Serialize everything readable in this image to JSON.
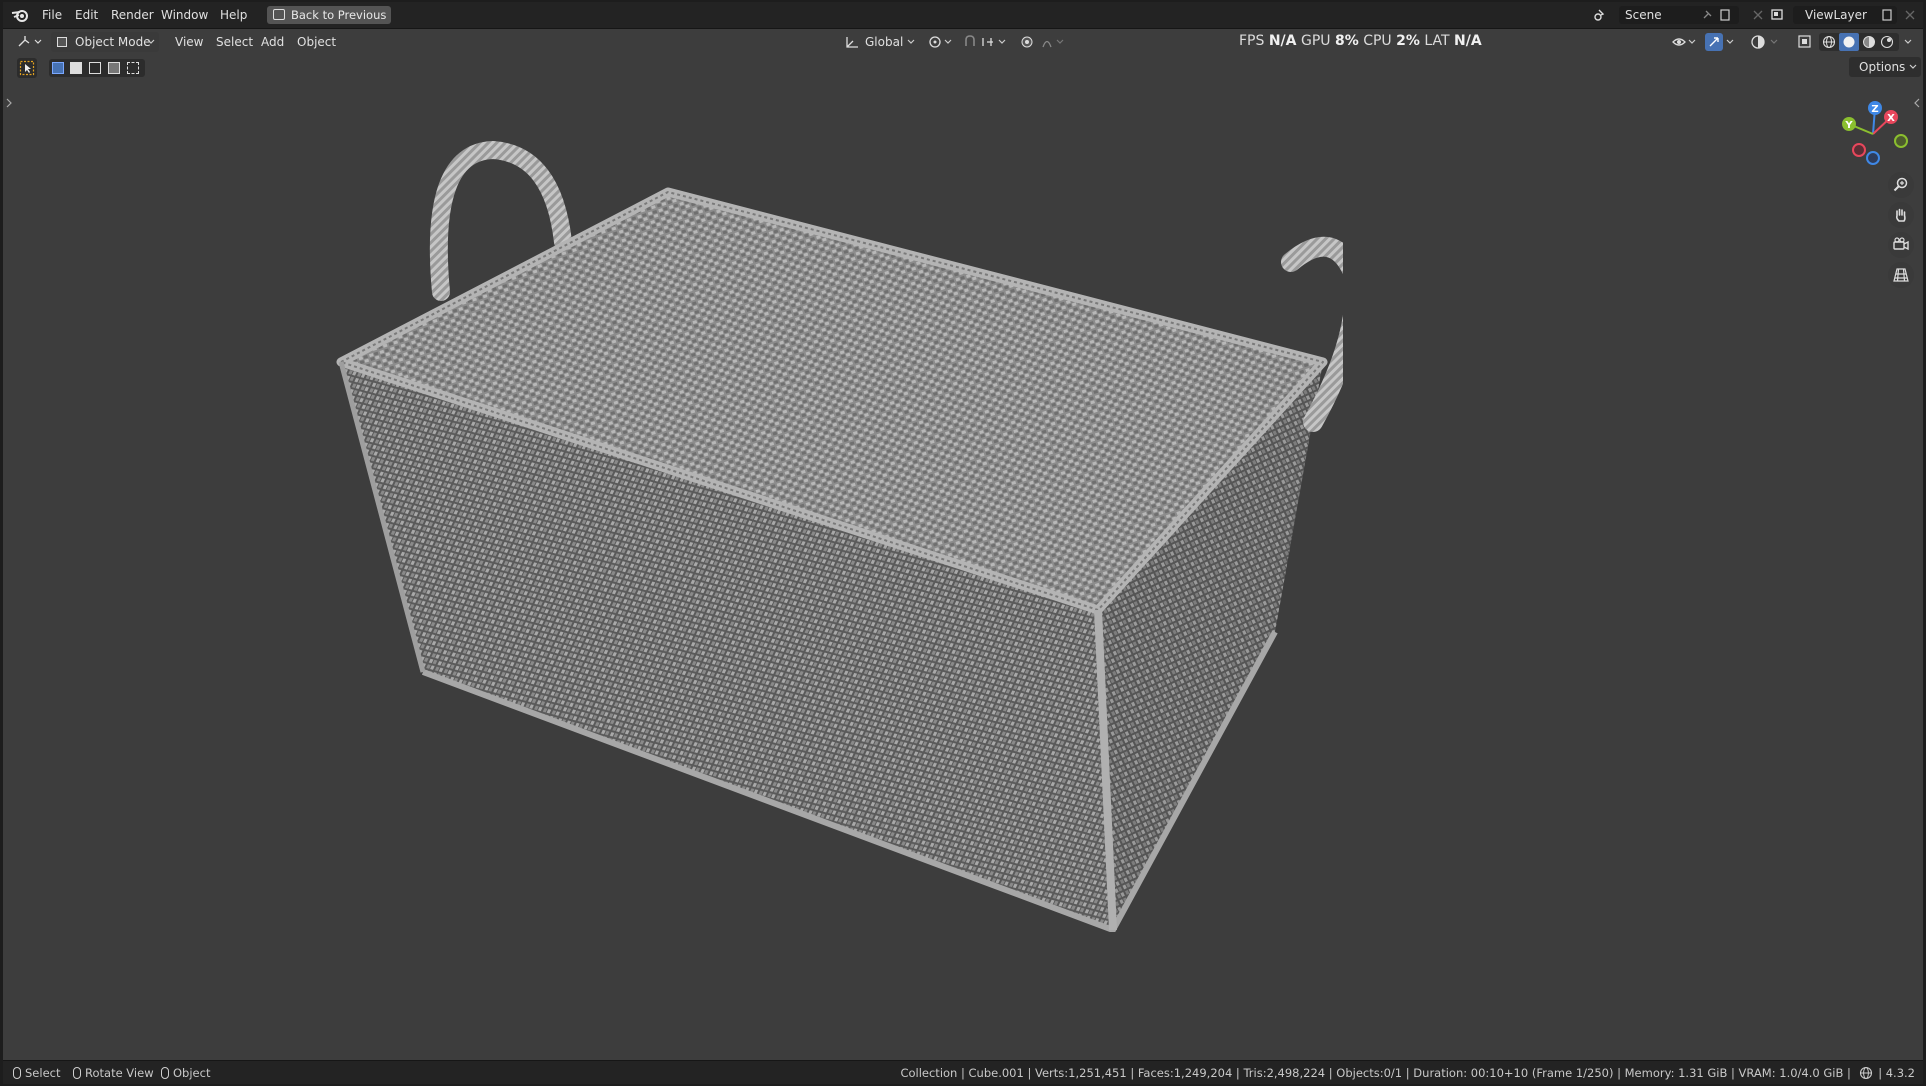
{
  "menu": [
    "File",
    "Edit",
    "Render",
    "Window",
    "Help"
  ],
  "back_button": "Back to Previous",
  "scene": "Scene",
  "view_layer": "ViewLayer",
  "header": {
    "mode": "Object Mode",
    "menus": [
      "View",
      "Select",
      "Add",
      "Object"
    ],
    "transform_orientation": "Global"
  },
  "stats": {
    "fps_label": "FPS",
    "fps_value": "N/A",
    "gpu_label": "GPU",
    "gpu_value": "8%",
    "cpu_label": "CPU",
    "cpu_value": "2%",
    "lat_label": "LAT",
    "lat_value": "N/A"
  },
  "options": "Options",
  "gizmo_axes": {
    "x": "X",
    "y": "Y",
    "z": "Z"
  },
  "status": {
    "select": "Select",
    "rotate": "Rotate View",
    "object": "Object",
    "info": "Collection | Cube.001 | Verts:1,251,451 | Faces:1,249,204 | Tris:2,498,224 | Objects:0/1 | Duration: 00:10+10 (Frame 1/250) | Memory: 1.31 GiB | VRAM: 1.0/4.0 GiB |",
    "version": "4.3.2"
  },
  "colors": {
    "x_axis": "#e8475c",
    "y_axis": "#8bbf2f",
    "z_axis": "#3f88e6",
    "accent": "#4772b3"
  }
}
